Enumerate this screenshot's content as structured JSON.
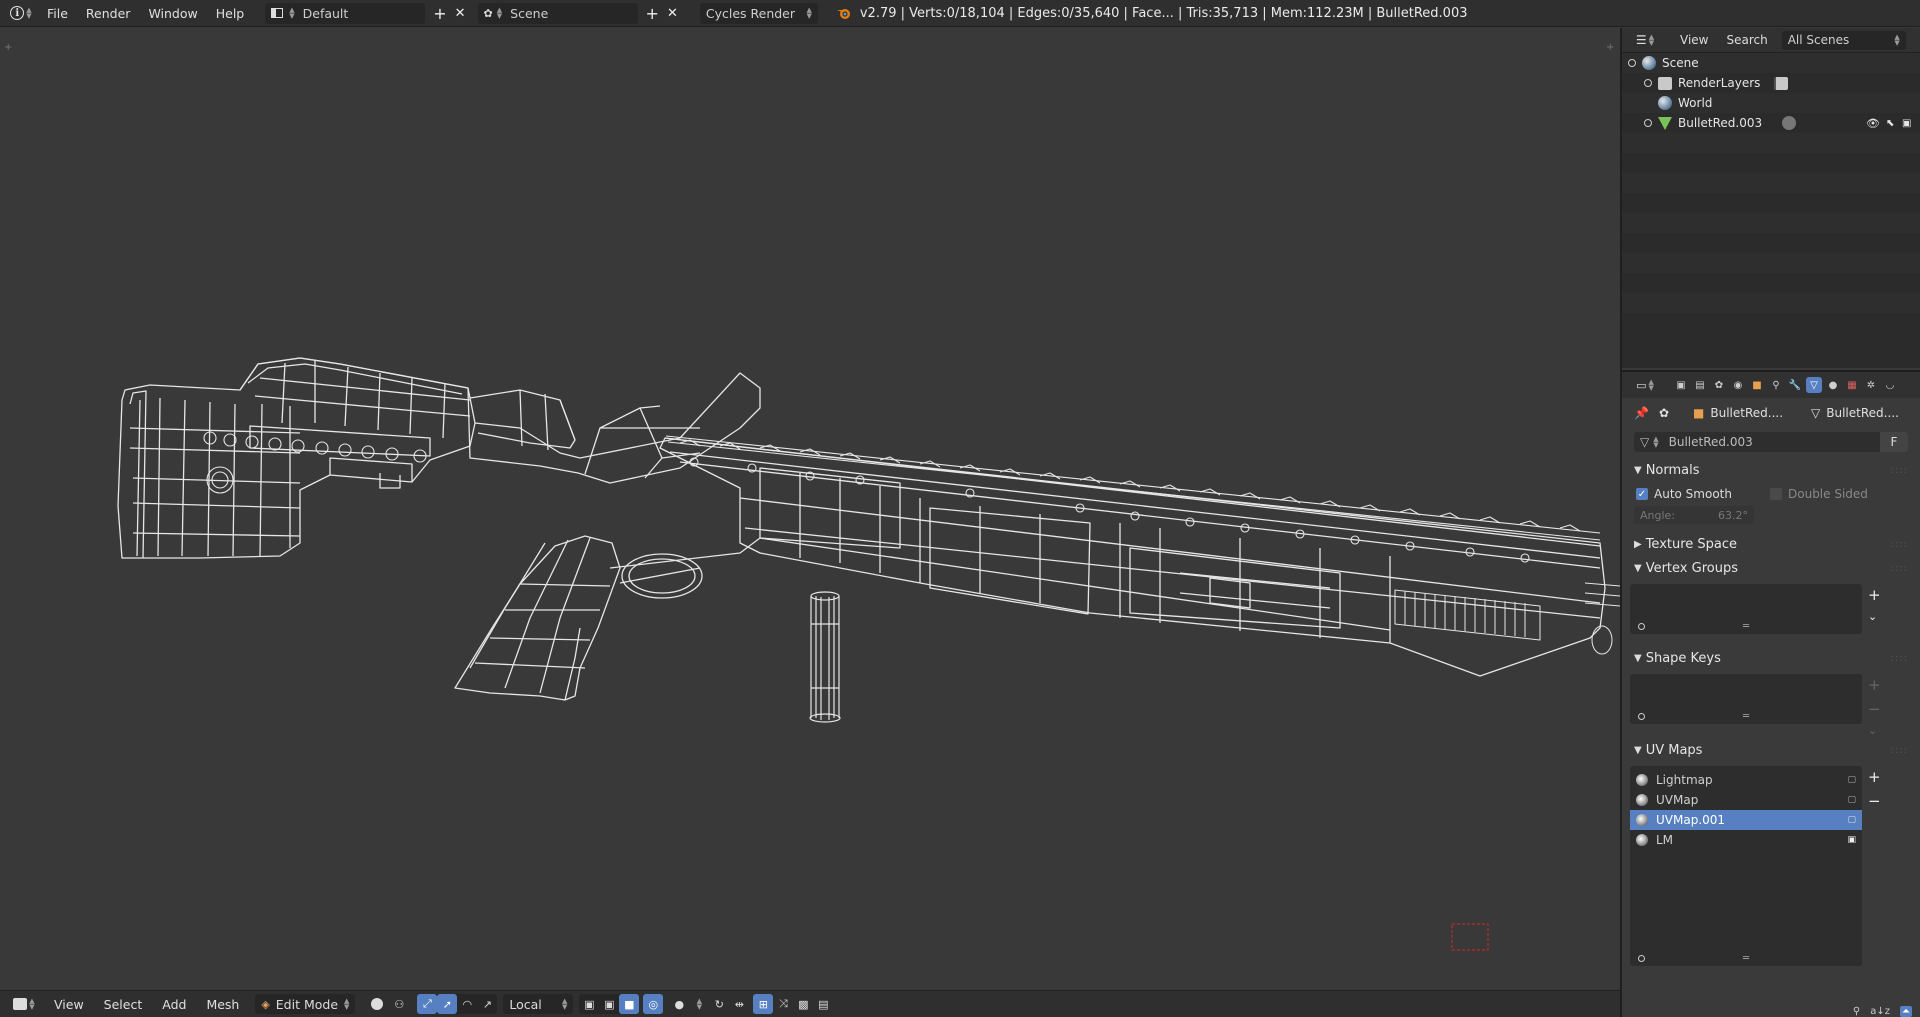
{
  "topbar": {
    "menus": [
      "File",
      "Render",
      "Window",
      "Help"
    ],
    "screen_layout": "Default",
    "scene": "Scene",
    "engine": "Cycles Render",
    "stats": "v2.79 | Verts:0/18,104 | Edges:0/35,640 | Face... | Tris:35,713 | Mem:112.23M | BulletRed.003"
  },
  "viewport_header": {
    "menus": [
      "View",
      "Select",
      "Add",
      "Mesh"
    ],
    "mode": "Edit Mode",
    "orientation": "Local"
  },
  "outliner": {
    "header": {
      "view": "View",
      "search": "Search",
      "display": "All Scenes"
    },
    "items": [
      {
        "label": "Scene",
        "icon": "scene-icon",
        "indent": 0
      },
      {
        "label": "RenderLayers",
        "icon": "render-layers-icon",
        "indent": 1
      },
      {
        "label": "World",
        "icon": "world-icon",
        "indent": 1
      },
      {
        "label": "BulletRed.003",
        "icon": "mesh-object-icon",
        "indent": 1
      }
    ]
  },
  "properties": {
    "breadcrumb": {
      "object": "BulletRed....",
      "mesh": "BulletRed...."
    },
    "mesh_name": "BulletRed.003",
    "fake_user": "F",
    "panels": {
      "normals": "Normals",
      "auto_smooth": "Auto Smooth",
      "auto_smooth_checked": true,
      "double_sided": "Double Sided",
      "double_sided_checked": false,
      "angle_label": "Angle:",
      "angle_value": "63.2°",
      "texture_space": "Texture Space",
      "vertex_groups": "Vertex Groups",
      "shape_keys": "Shape Keys",
      "uv_maps": "UV Maps"
    },
    "uv_maps": [
      {
        "name": "Lightmap",
        "selected": false
      },
      {
        "name": "UVMap",
        "selected": false
      },
      {
        "name": "UVMap.001",
        "selected": true
      },
      {
        "name": "LM",
        "selected": false
      }
    ]
  },
  "colors": {
    "accent": "#5680c2",
    "viewport_bg": "#393939",
    "wire": "#e8e8e8"
  }
}
